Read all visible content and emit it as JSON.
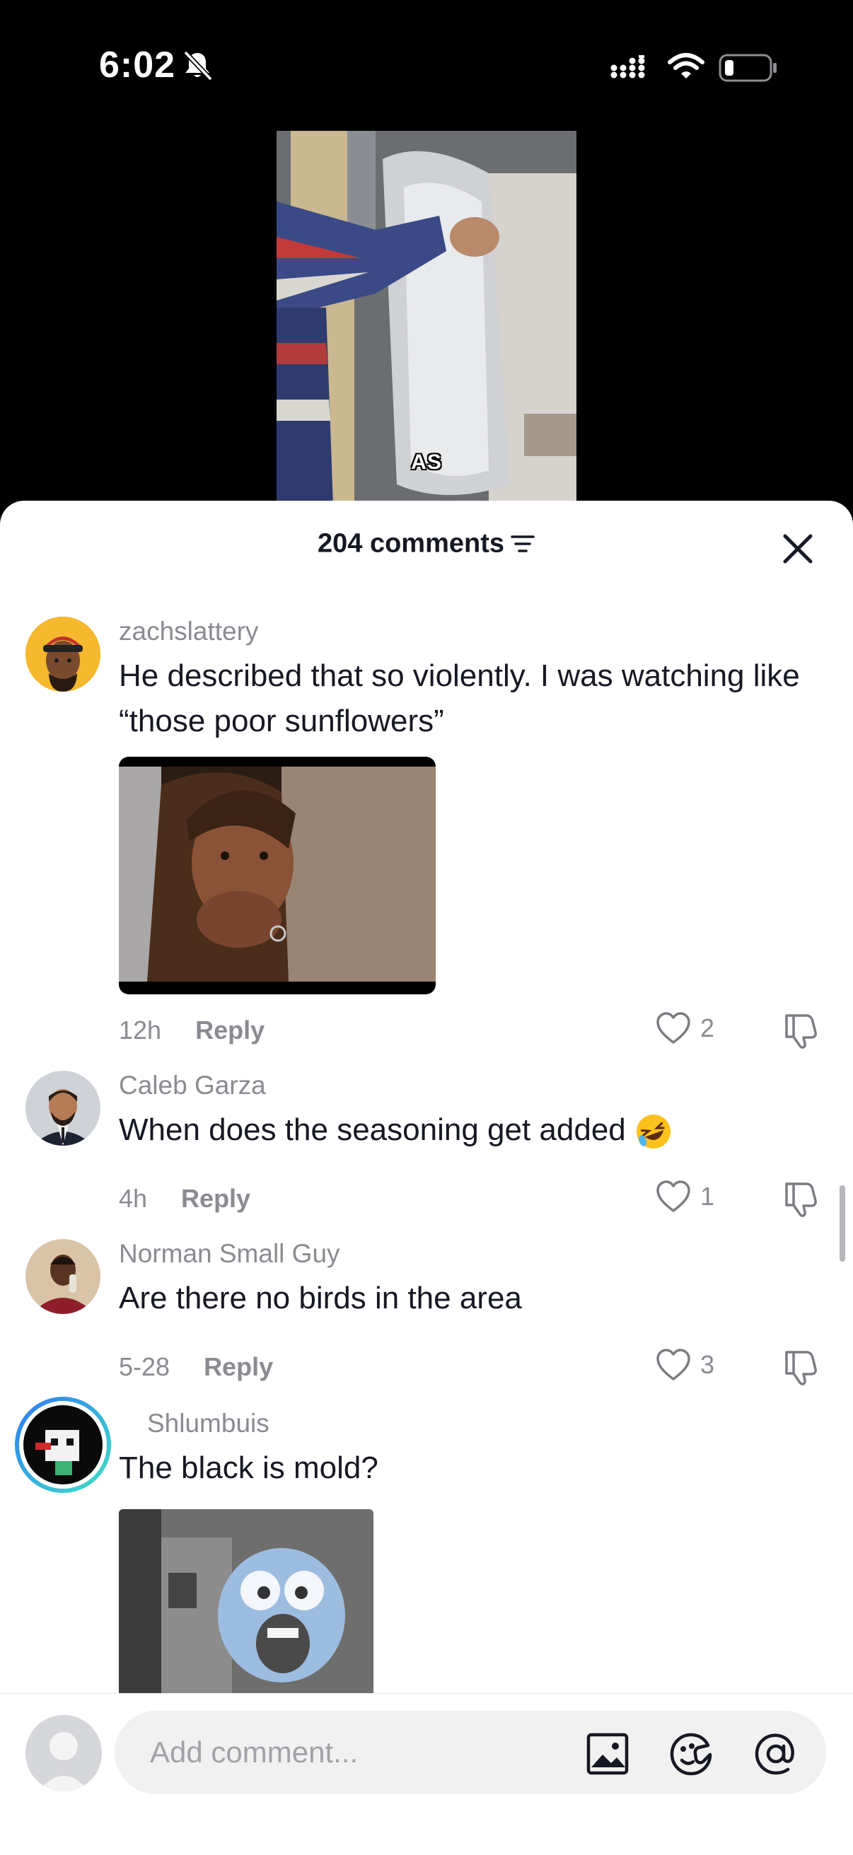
{
  "status_bar": {
    "time": "6:02"
  },
  "video": {
    "caption": "AS"
  },
  "comments_sheet": {
    "count_label": "204 comments"
  },
  "comments": [
    {
      "username": "zachslattery",
      "text": "He described that so violently. I was watching like “those poor sunflowers”",
      "time": "12h",
      "reply_label": "Reply",
      "likes": "2"
    },
    {
      "username": "Caleb Garza",
      "text": "When does the seasoning get added",
      "time": "4h",
      "reply_label": "Reply",
      "likes": "1"
    },
    {
      "username": "Norman Small Guy",
      "text": "Are there no birds in the area",
      "time": "5-28",
      "reply_label": "Reply",
      "likes": "3"
    },
    {
      "username": "Shlumbuis",
      "text": "The black is mold?"
    }
  ],
  "composer": {
    "placeholder": "Add comment..."
  },
  "colors": {
    "text": "#161823",
    "muted": "#8a8b91",
    "sheet": "#ffffff",
    "input_bg": "#f1f1f2"
  },
  "icons": [
    "bell-slash-icon",
    "signal-icon",
    "wifi-icon",
    "battery-icon",
    "sort-icon",
    "close-icon",
    "heart-icon",
    "dislike-icon",
    "laughing-emoji-icon",
    "image-icon",
    "sticker-icon",
    "mention-icon"
  ]
}
